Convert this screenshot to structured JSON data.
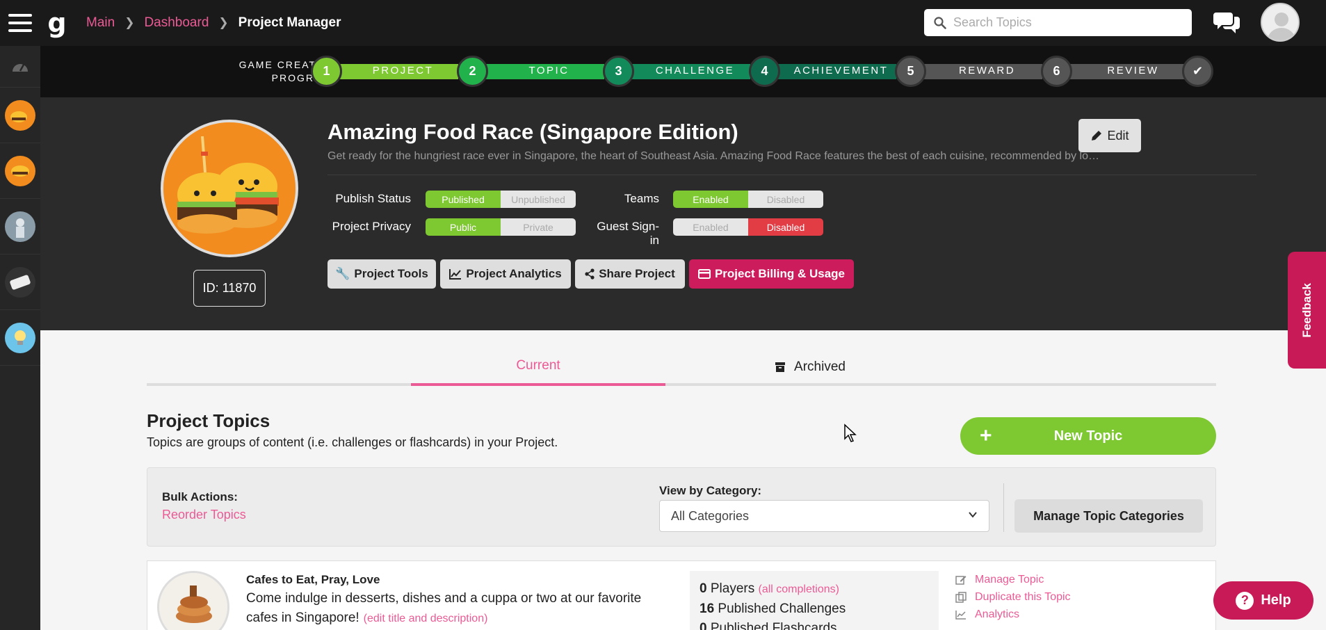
{
  "topbar": {
    "logo": "g",
    "breadcrumb": [
      "Main",
      "Dashboard",
      "Project Manager"
    ],
    "search_placeholder": "Search Topics"
  },
  "progress": {
    "label_line1": "GAME CREATION",
    "label_line2": "PROGRESS",
    "stages": [
      {
        "num": "1",
        "label": "PROJECT",
        "color": "#7ec832"
      },
      {
        "num": "2",
        "label": "TOPIC",
        "color": "#22b24c"
      },
      {
        "num": "3",
        "label": "CHALLENGE",
        "color": "#138a5a"
      },
      {
        "num": "4",
        "label": "ACHIEVEMENT",
        "color": "#0f6b4e"
      },
      {
        "num": "5",
        "label": "REWARD",
        "color": "#555555"
      },
      {
        "num": "6",
        "label": "REVIEW",
        "color": "#555555"
      }
    ],
    "final_icon": "check-icon"
  },
  "project": {
    "title": "Amazing Food Race (Singapore Edition)",
    "description": "Get ready for the hungriest race ever in Singapore, the heart of Southeast Asia. Amazing Food Race features the best of each cuisine, recommended by locals and foodies alike...",
    "id_label": "ID: 11870",
    "edit_label": "Edit",
    "settings": {
      "publish_status_label": "Publish Status",
      "publish_on": "Published",
      "publish_off": "Unpublished",
      "privacy_label": "Project Privacy",
      "privacy_on": "Public",
      "privacy_off": "Private",
      "teams_label": "Teams",
      "teams_on": "Enabled",
      "teams_off": "Disabled",
      "guest_label": "Guest Sign-in",
      "guest_on": "Enabled",
      "guest_off": "Disabled"
    },
    "actions": {
      "tools": "Project Tools",
      "analytics": "Project Analytics",
      "share": "Share Project",
      "billing": "Project Billing & Usage"
    }
  },
  "feedback_label": "Feedback",
  "tabs": {
    "current": "Current",
    "archived": "Archived"
  },
  "topics": {
    "title": "Project Topics",
    "subtitle": "Topics are groups of content (i.e. challenges or flashcards) in your Project.",
    "new_topic": "New Topic",
    "bulk_label": "Bulk Actions:",
    "reorder": "Reorder Topics",
    "view_by_label": "View by Category:",
    "category_selected": "All Categories",
    "manage_categories": "Manage Topic Categories",
    "items": [
      {
        "title": "Cafes to Eat, Pray, Love",
        "description": "Come indulge in desserts, dishes and a cuppa or two at our favorite cafes in Singapore!",
        "edit_link": "(edit title and description)",
        "players_count": "0",
        "players_label": "Players",
        "completions_link": "(all completions)",
        "challenges_count": "16",
        "challenges_label": "Published Challenges",
        "flashcards_count": "0",
        "flashcards_label": "Published Flashcards",
        "actions": [
          "Manage Topic",
          "Duplicate this Topic",
          "Analytics"
        ]
      }
    ]
  },
  "help_label": "Help",
  "colors": {
    "accent_pink": "#ec5a95",
    "brand_green": "#7ec832",
    "billing_red": "#cc1c5c",
    "disabled_red": "#e23c44"
  }
}
